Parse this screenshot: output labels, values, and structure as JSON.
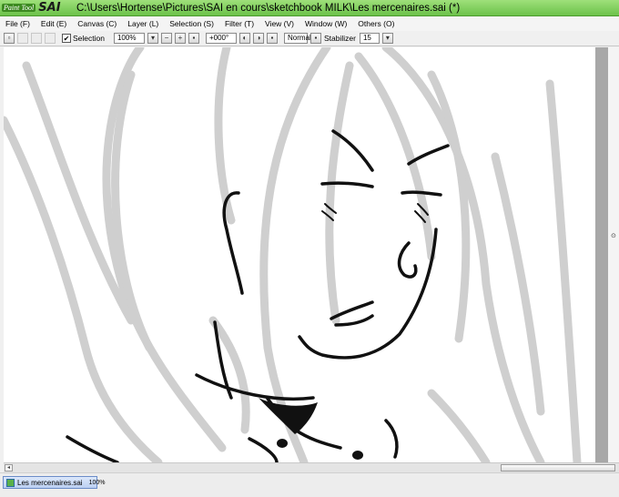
{
  "app": {
    "logo_small": "Paint Tool",
    "logo_big": "SAI",
    "title": "C:\\Users\\Hortense\\Pictures\\SAI en cours\\sketchbook MILK\\Les mercenaires.sai (*)"
  },
  "menu": [
    "File (F)",
    "Edit (E)",
    "Canvas (C)",
    "Layer (L)",
    "Selection (S)",
    "Filter (T)",
    "View (V)",
    "Window (W)",
    "Others (O)"
  ],
  "toolbar": {
    "selection_label": "Selection",
    "selection_checked": "✔",
    "zoom_value": "100%",
    "rotation_value": "+000°",
    "blend_value": "Normal",
    "stabilizer_label": "Stabilizer",
    "stabilizer_value": "15"
  },
  "document": {
    "tab_name": "Les mercenaires.sai",
    "tab_zoom": "100%"
  },
  "icons": {
    "nav_dot": "⊙",
    "scroll_left": "◂"
  }
}
